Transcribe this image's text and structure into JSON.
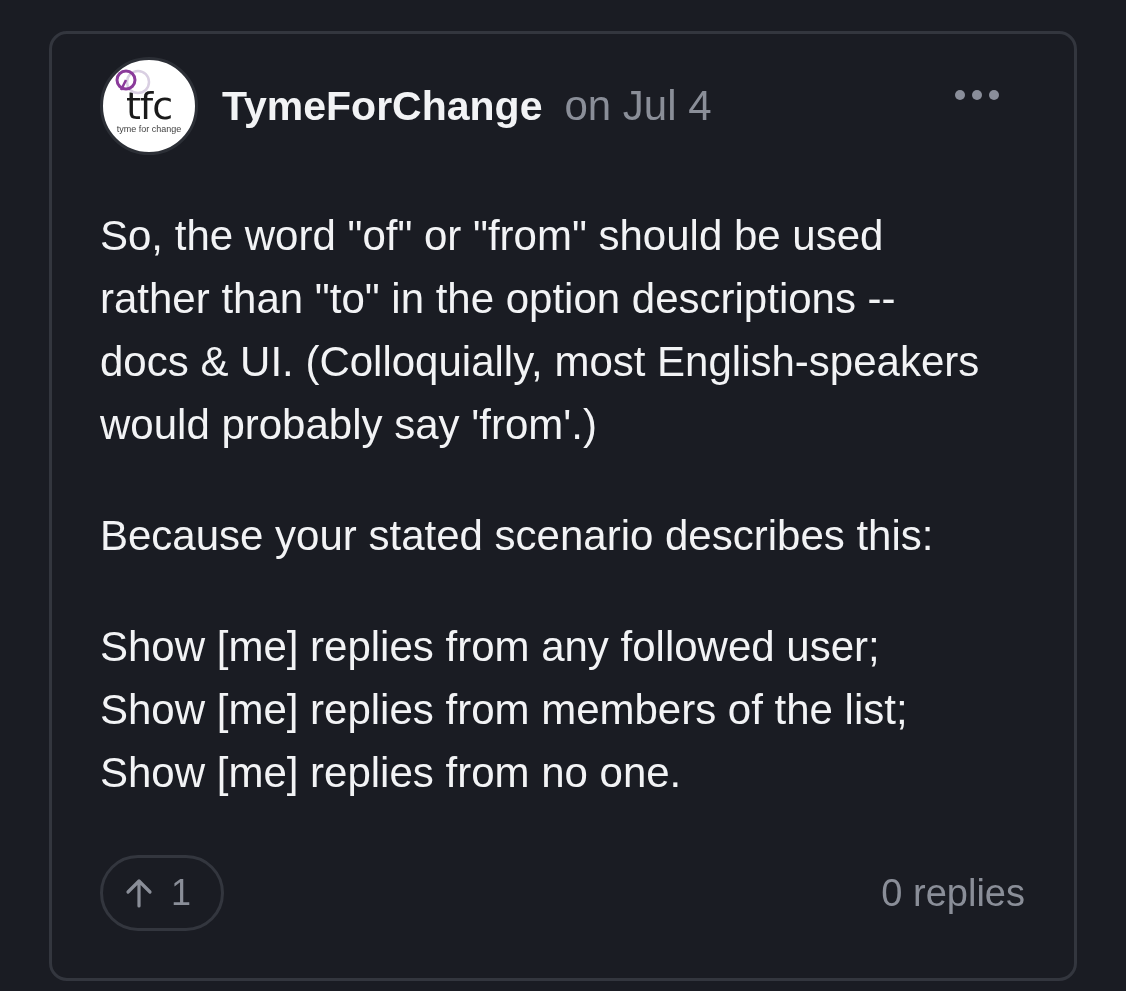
{
  "post": {
    "author": {
      "name": "TymeForChange",
      "avatar": {
        "logo_text": "tfc",
        "tagline": "tyme for change"
      }
    },
    "date": "on Jul 4",
    "paragraphs": [
      "So, the word \"of\" or \"from\" should be used rather than \"to\" in the option descriptions -- docs & UI. (Colloquially, most English-speakers would probably say 'from'.)",
      "Because your stated scenario describes this:",
      "Show [me] replies from any followed user;\nShow [me] replies from members of the list;\nShow [me] replies from no one."
    ],
    "upvotes": {
      "count": "1"
    },
    "replies": "0 replies"
  }
}
